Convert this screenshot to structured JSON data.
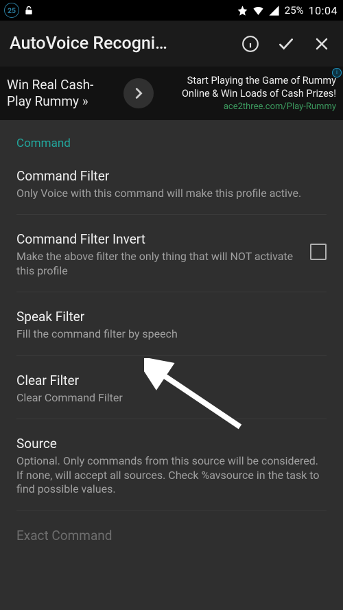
{
  "status": {
    "badge": "25",
    "battery": "25%",
    "clock": "10:04"
  },
  "header": {
    "title": "AutoVoice Recogni…"
  },
  "ad": {
    "left_line1": "Win Real Cash-",
    "left_line2": "Play Rummy »",
    "right_line1": "Start Playing the Game of Rummy",
    "right_line2": "Online & Win Loads of Cash Prizes!",
    "right_link": "ace2three.com/Play-Rummy",
    "info_badge": "i"
  },
  "section_header": "Command",
  "rows": {
    "filter": {
      "title": "Command Filter",
      "sub": "Only Voice with this command will make this profile active."
    },
    "filter_invert": {
      "title": "Command Filter Invert",
      "sub": "Make the above filter the only thing that will NOT activate this profile",
      "checked": false
    },
    "speak_filter": {
      "title": "Speak Filter",
      "sub": "Fill the command filter by speech"
    },
    "clear_filter": {
      "title": "Clear Filter",
      "sub": "Clear Command Filter"
    },
    "source": {
      "title": "Source",
      "sub": "Optional. Only commands from this source will be considered. If none, will accept all sources. Check %avsource in the task to find possible values."
    },
    "exact_command": {
      "title": "Exact Command"
    }
  }
}
